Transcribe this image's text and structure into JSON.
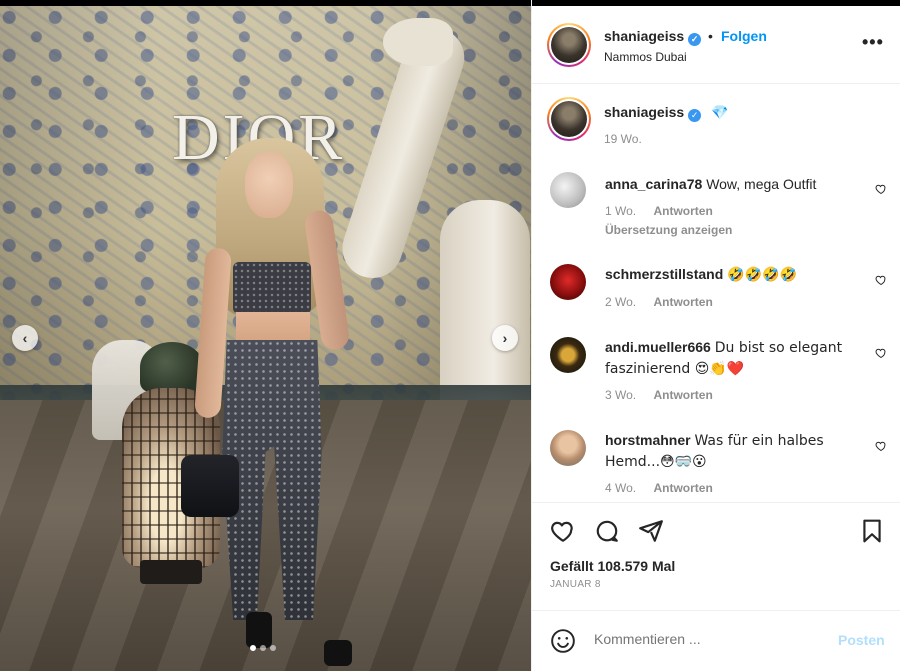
{
  "post": {
    "username": "shaniageiss",
    "separator": "•",
    "follow_label": "Folgen",
    "location": "Nammos Dubai",
    "more_icon": "more-horizontal-icon",
    "verified_icon": "verified-badge-icon",
    "photo_brand_text": "DIOR"
  },
  "caption": {
    "username": "shaniageiss",
    "text": "💎",
    "age": "19 Wo."
  },
  "comments": [
    {
      "username": "anna_carina78",
      "text": "Wow, mega Outfit",
      "age": "1 Wo.",
      "reply": "Antworten",
      "translate": "Übersetzung anzeigen"
    },
    {
      "username": "schmerzstillstand",
      "text": "🤣🤣🤣🤣",
      "age": "2 Wo.",
      "reply": "Antworten"
    },
    {
      "username": "andi.mueller666",
      "text": "Du bist so elegant faszinierend 😍👏❤️",
      "age": "3 Wo.",
      "reply": "Antworten"
    },
    {
      "username": "horstmahner",
      "text": "Was für ein halbes Hemd...😳🥽😮",
      "age": "4 Wo.",
      "reply": "Antworten"
    }
  ],
  "actions": {
    "likes": "Gefällt 108.579 Mal",
    "date": "JANUAR 8"
  },
  "comment_box": {
    "placeholder": "Kommentieren ...",
    "post_label": "Posten"
  },
  "carousel": {
    "prev_icon": "chevron-left-icon",
    "next_icon": "chevron-right-icon",
    "prev_glyph": "‹",
    "next_glyph": "›",
    "slide_count": 3,
    "active_slide": 1
  },
  "colors": {
    "link_blue": "#0095f6",
    "verified_blue": "#3897f0",
    "muted": "#8e8e8e",
    "post_disabled": "#b2dffc"
  }
}
